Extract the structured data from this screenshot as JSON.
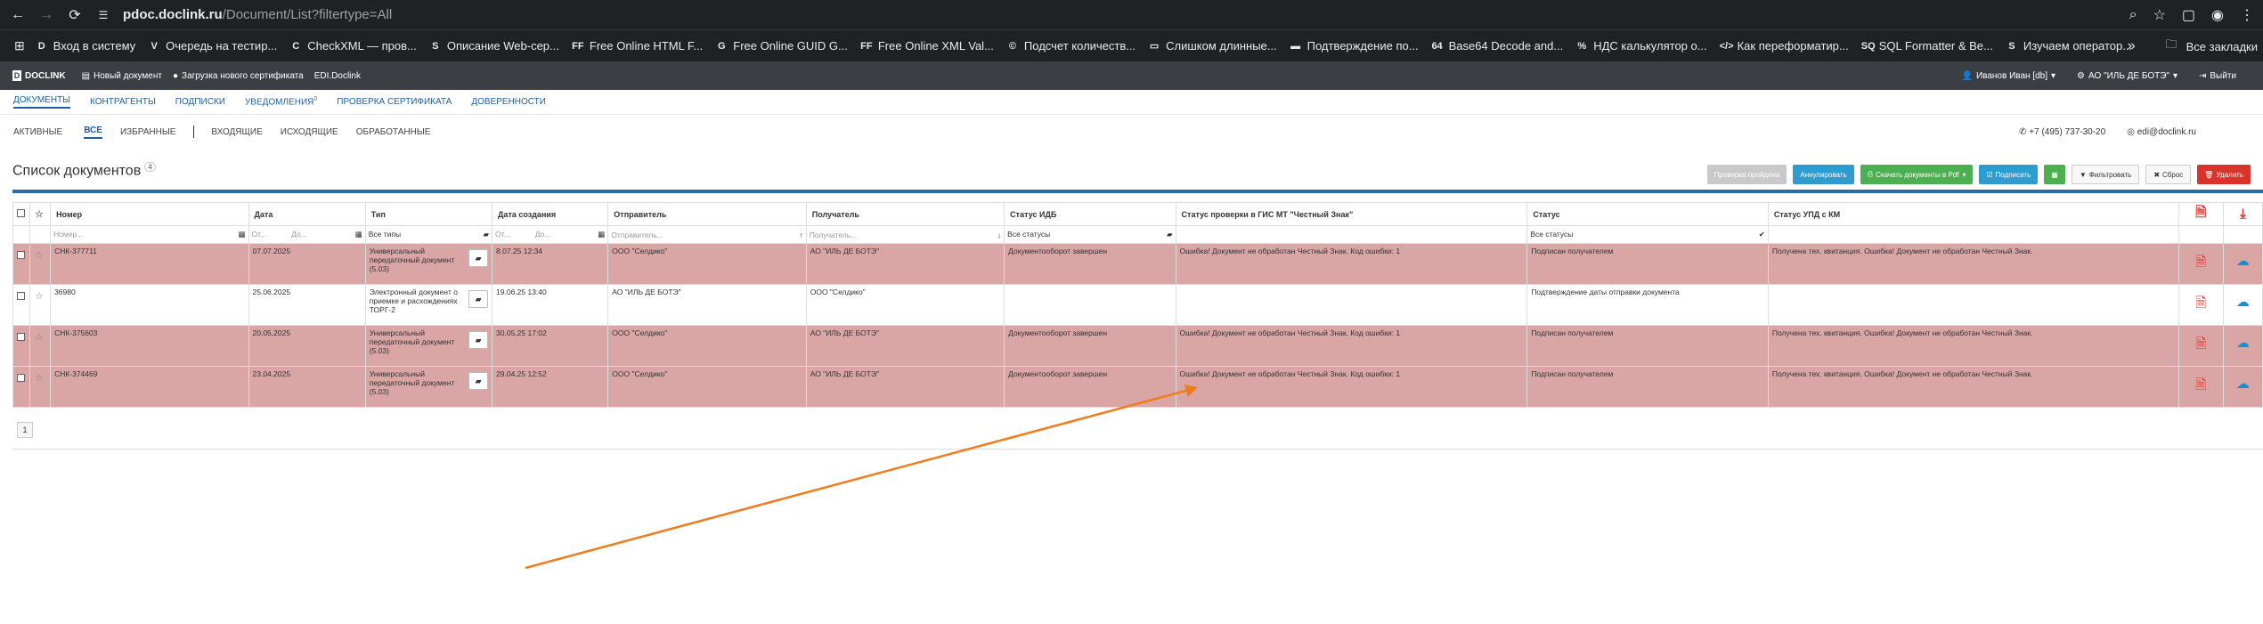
{
  "browser": {
    "url_host": "pdoc.doclink.ru",
    "url_path": "/Document/List?filtertype=All",
    "bookmarks": [
      {
        "label": "Вход в систему",
        "icon": "D"
      },
      {
        "label": "Очередь на тестир...",
        "icon": "V"
      },
      {
        "label": "CheckXML — пров...",
        "icon": "C"
      },
      {
        "label": "Описание Web-сер...",
        "icon": "S"
      },
      {
        "label": "Free Online HTML F...",
        "icon": "FF"
      },
      {
        "label": "Free Online GUID G...",
        "icon": "G"
      },
      {
        "label": "Free Online XML Val...",
        "icon": "FF"
      },
      {
        "label": "Подсчет количеств...",
        "icon": "©"
      },
      {
        "label": "Слишком длинные...",
        "icon": "▭"
      },
      {
        "label": "Подтверждение по...",
        "icon": "▬"
      },
      {
        "label": "Base64 Decode and...",
        "icon": "64"
      },
      {
        "label": "НДС калькулятор о...",
        "icon": "%"
      },
      {
        "label": "Как переформатир...",
        "icon": "</>"
      },
      {
        "label": "SQL Formatter & Be...",
        "icon": "SQ"
      },
      {
        "label": "Изучаем оператор...",
        "icon": "S"
      }
    ],
    "bookmarks_more": "»",
    "bookmarks_folder": "Все закладки"
  },
  "appbar": {
    "logo": "DOCLINK",
    "new_doc": "Новый документ",
    "upload_cert": "Загрузка нового сертификата",
    "edi": "EDI.Doclink",
    "user": "Иванов Иван [db]",
    "org": "АО \"ИЛЬ ДЕ БОТЭ\"",
    "exit": "Выйти"
  },
  "mainnav": {
    "items": [
      "ДОКУМЕНТЫ",
      "КОНТРАГЕНТЫ",
      "ПОДПИСКИ",
      "УВЕДОМЛЕНИЯ",
      "ПРОВЕРКА СЕРТИФИКАТА",
      "ДОВЕРЕННОСТИ"
    ],
    "notifications_count": "0"
  },
  "subnav": {
    "items": [
      "АКТИВНЫЕ",
      "ВСЕ",
      "ИЗБРАННЫЕ"
    ],
    "items2": [
      "ВХОДЯЩИЕ",
      "ИСХОДЯЩИЕ",
      "ОБРАБОТАННЫЕ"
    ],
    "phone": "+7 (495) 737-30-20",
    "email": "edi@doclink.ru"
  },
  "page": {
    "title": "Список документов",
    "count": "4"
  },
  "toolbar": {
    "check_passed": "Проверка пройдена",
    "annul": "Аннулировать",
    "download_pdf": "Скачать документы в Pdf",
    "sign": "Подписать",
    "filter": "Фильтровать",
    "reset": "Сброс",
    "delete": "Удалить"
  },
  "table": {
    "headers": [
      "Номер",
      "Дата",
      "Тип",
      "Дата создания",
      "Отправитель",
      "Получатель",
      "Статус ИДБ",
      "Статус проверки в ГИС МТ \"Честный Знак\"",
      "Статус",
      "Статус УПД с КМ"
    ],
    "filters": {
      "number": "Номер...",
      "date_from": "От...",
      "date_to": "До...",
      "type": "Все типы",
      "created_from": "От...",
      "created_to": "До...",
      "sender": "Отправитель...",
      "receiver": "Получатель...",
      "idb": "Все статусы",
      "status": "Все статусы"
    },
    "rows": [
      {
        "number": "СНК-377711",
        "date": "07.07.2025",
        "type": "Универсальный передаточный документ (5.03)",
        "created": "8.07.25 12:34",
        "sender": "ООО \"Селдико\"",
        "receiver": "АО \"ИЛЬ ДЕ БОТЭ\"",
        "idb": "Документооборот завершен",
        "gis": "Ошибка! Документ не обработан Честный Знак. Код ошибки: 1",
        "status": "Подписан получателем",
        "upd": "Получена тех. квитанция. Ошибка! Документ не обработан Честный Знак.",
        "highlight": true
      },
      {
        "number": "36980",
        "date": "25.06.2025",
        "type": "Электронный документ о приемке и расхождениях ТОРГ-2",
        "created": "19.06.25 13:40",
        "sender": "АО \"ИЛЬ ДЕ БОТЭ\"",
        "receiver": "ООО \"Селдико\"",
        "idb": "",
        "gis": "",
        "status": "Подтверждение даты отправки документа",
        "upd": "",
        "highlight": false
      },
      {
        "number": "СНК-375603",
        "date": "20.05.2025",
        "type": "Универсальный передаточный документ (5.03)",
        "created": "30.05.25 17:02",
        "sender": "ООО \"Селдико\"",
        "receiver": "АО \"ИЛЬ ДЕ БОТЭ\"",
        "idb": "Документооборот завершен",
        "gis": "Ошибка! Документ не обработан Честный Знак. Код ошибки: 1",
        "status": "Подписан получателем",
        "upd": "Получена тех. квитанция. Ошибка! Документ не обработан Честный Знак.",
        "highlight": true
      },
      {
        "number": "СНК-374469",
        "date": "23.04.2025",
        "type": "Универсальный передаточный документ (5.03)",
        "created": "29.04.25 12:52",
        "sender": "ООО \"Селдико\"",
        "receiver": "АО \"ИЛЬ ДЕ БОТЭ\"",
        "idb": "Документооборот завершен",
        "gis": "Ошибка! Документ не обработан Честный Знак. Код ошибки: 1",
        "status": "Подписан получателем",
        "upd": "Получена тех. квитанция. Ошибка! Документ не обработан Честный Знак.",
        "highlight": true
      }
    ]
  },
  "pager": {
    "current": "1"
  },
  "colors": {
    "highlight_row": "#d9a5a5",
    "accent_blue": "#2a6aa8",
    "annotation_arrow": "#f07c1e"
  }
}
